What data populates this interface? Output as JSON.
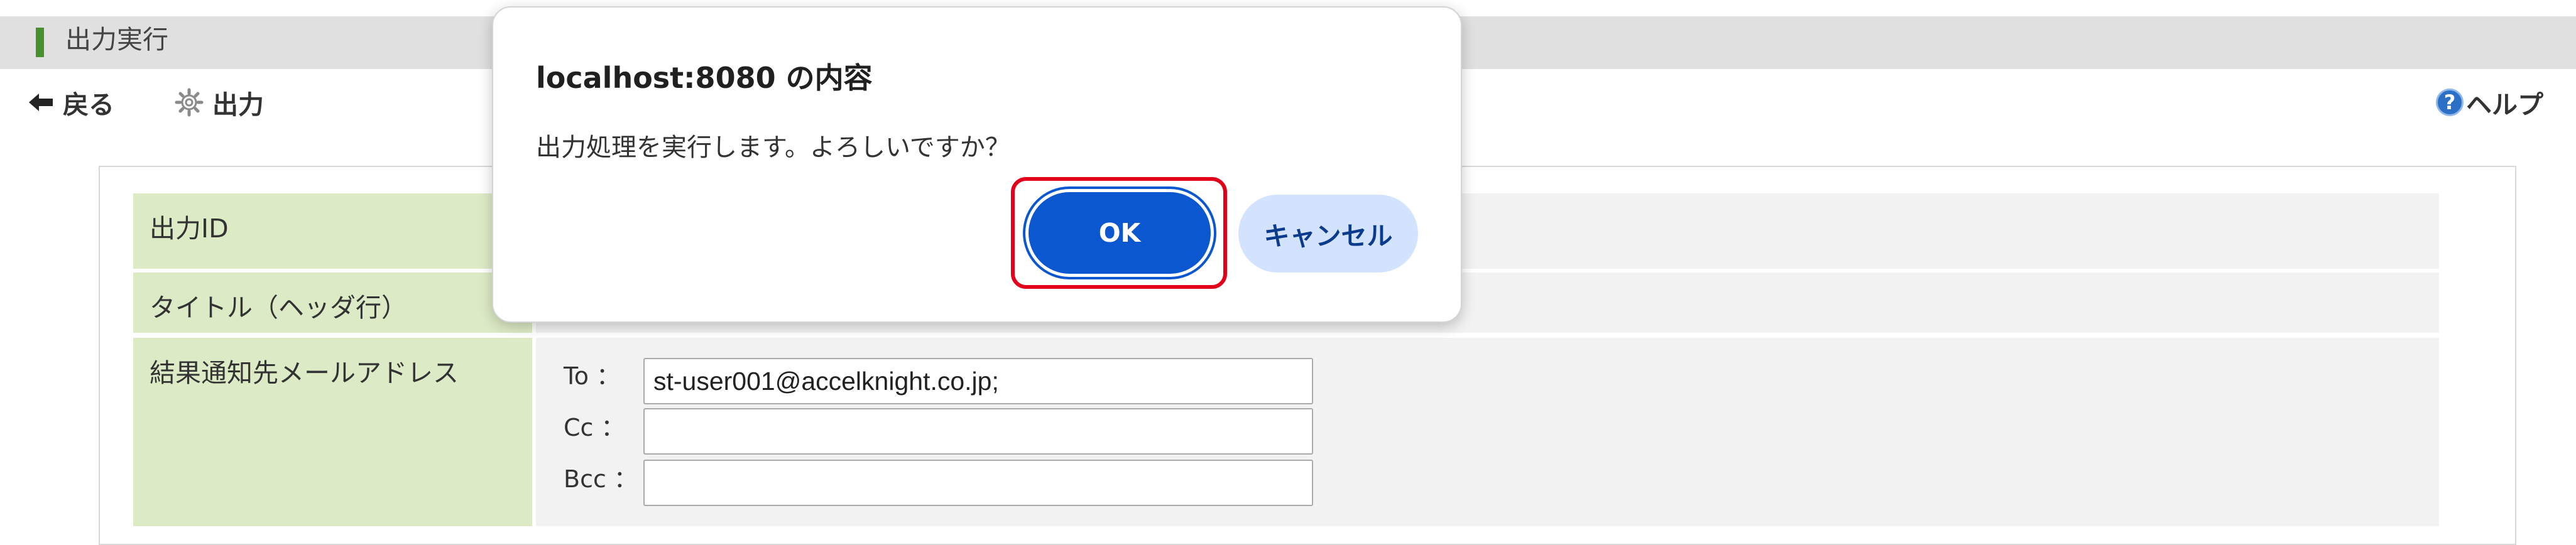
{
  "page": {
    "title": "出力実行"
  },
  "toolbar": {
    "back_label": "戻る",
    "output_label": "出力",
    "help_label": "ヘルプ",
    "help_icon_glyph": "?",
    "accent_color": "#4a8f2e"
  },
  "form": {
    "rows": [
      {
        "label": "出力ID"
      },
      {
        "label": "タイトル（ヘッダ行）"
      },
      {
        "label": "結果通知先メールアドレス"
      }
    ],
    "mail": {
      "to_label": "To ：",
      "to_value": "st-user001@accelknight.co.jp;",
      "cc_label": "Cc ：",
      "cc_value": "",
      "bcc_label": "Bcc ：",
      "bcc_value": ""
    },
    "label_bg_color": "#ddeac6"
  },
  "dialog": {
    "title": "localhost:8080 の内容",
    "message": "出力処理を実行します。よろしいですか？",
    "ok_label": "OK",
    "cancel_label": "キャンセル",
    "ok_color": "#0b57d0",
    "cancel_color": "#d3e3fd",
    "highlight_color": "#e2001a"
  }
}
